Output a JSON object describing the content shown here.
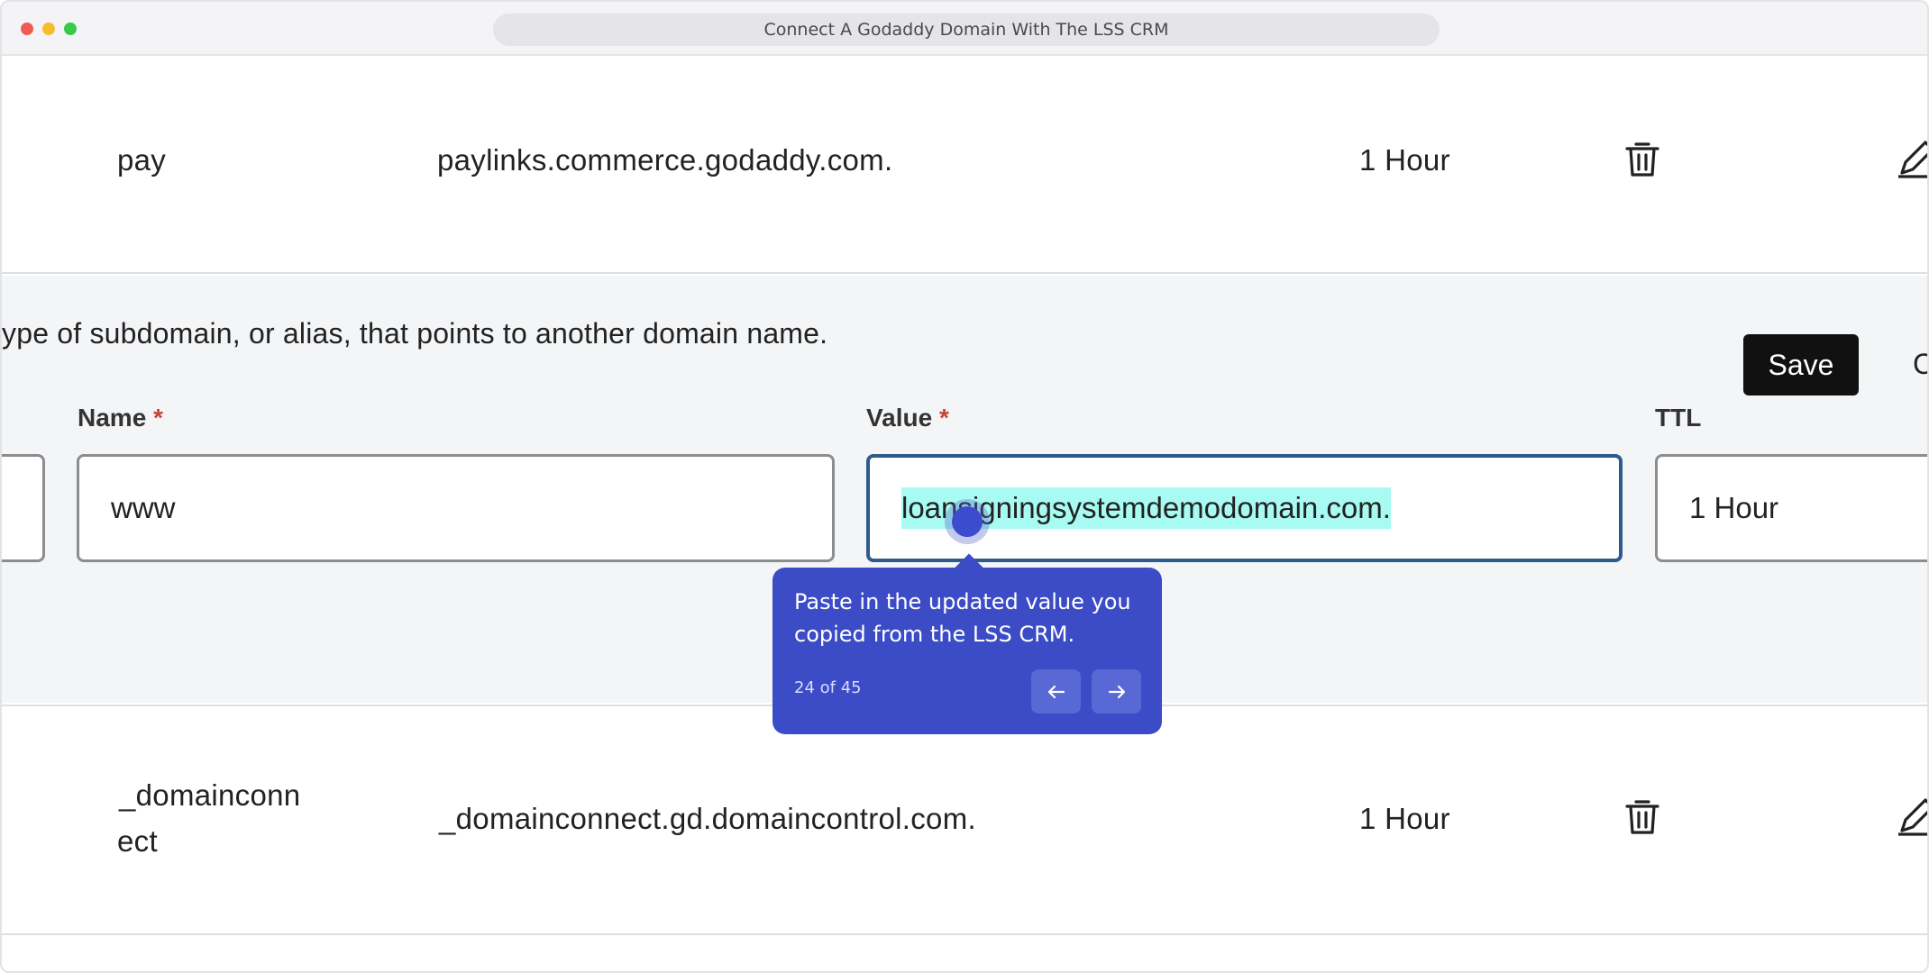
{
  "window": {
    "title": "Connect A Godaddy Domain With The LSS CRM"
  },
  "records": [
    {
      "name": "pay",
      "value": "paylinks.commerce.godaddy.com.",
      "ttl": "1 Hour"
    },
    {
      "name_line1": "_domainconn",
      "name_line2": "ect",
      "value": "_domainconnect.gd.domaincontrol.com.",
      "ttl": "1 Hour"
    }
  ],
  "edit_form": {
    "description": "ype of subdomain, or alias, that points to another domain name.",
    "name_label": "Name",
    "value_label": "Value",
    "ttl_label": "TTL",
    "required_mark": "*",
    "name_value": "www",
    "value_value": "loansigningsystemdemodomain.com.",
    "ttl_value": "1 Hour",
    "save_label": "Save",
    "cancel_partial": "C"
  },
  "tooltip": {
    "text": "Paste in the updated value you copied from the LSS CRM.",
    "step": "24 of 45"
  },
  "colors": {
    "tooltip_bg": "#3b4cc6",
    "highlight": "#a8fbf2",
    "save_bg": "#111111",
    "focus_border": "#2e5b8e",
    "required": "#c9423a"
  }
}
